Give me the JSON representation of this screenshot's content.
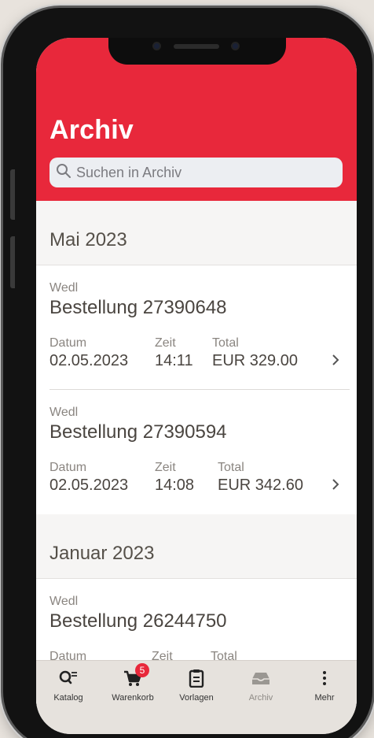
{
  "header": {
    "title": "Archiv",
    "search_placeholder": "Suchen in Archiv"
  },
  "sections": [
    {
      "month": "Mai 2023",
      "orders": [
        {
          "supplier": "Wedl",
          "title": "Bestellung 27390648",
          "date_label": "Datum",
          "date": "02.05.2023",
          "time_label": "Zeit",
          "time": "14:11",
          "total_label": "Total",
          "total": "EUR 329.00"
        },
        {
          "supplier": "Wedl",
          "title": "Bestellung 27390594",
          "date_label": "Datum",
          "date": "02.05.2023",
          "time_label": "Zeit",
          "time": "14:08",
          "total_label": "Total",
          "total": "EUR 342.60"
        }
      ]
    },
    {
      "month": "Januar 2023",
      "orders": [
        {
          "supplier": "Wedl",
          "title": "Bestellung 26244750",
          "date_label": "Datum",
          "time_label": "Zeit",
          "total_label": "Total"
        }
      ]
    }
  ],
  "tabbar": {
    "active": "Archiv",
    "cart_badge": "5",
    "tabs": [
      {
        "label": "Katalog",
        "icon": "catalog-search-icon"
      },
      {
        "label": "Warenkorb",
        "icon": "cart-icon"
      },
      {
        "label": "Vorlagen",
        "icon": "clipboard-icon"
      },
      {
        "label": "Archiv",
        "icon": "archive-tray-icon"
      },
      {
        "label": "Mehr",
        "icon": "more-vertical-icon"
      }
    ]
  },
  "colors": {
    "brand_red": "#e8283b",
    "background": "#f6f5f4",
    "tabbar": "#e6e2dd"
  }
}
